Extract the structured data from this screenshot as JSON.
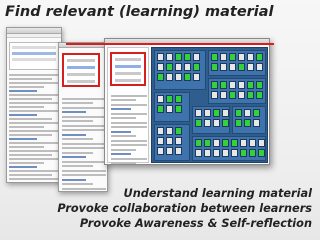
{
  "slide": {
    "title": "Find relevant (learning) material",
    "bullets": [
      "Understand learning material",
      "Provoke collaboration between learners",
      "Provoke Awareness & Self-reflection"
    ]
  },
  "colors": {
    "highlight_red": "#d62020",
    "treemap_blue": "#3e73ad",
    "cell_green": "#34d23a",
    "cell_gray": "#e7e7e7"
  }
}
